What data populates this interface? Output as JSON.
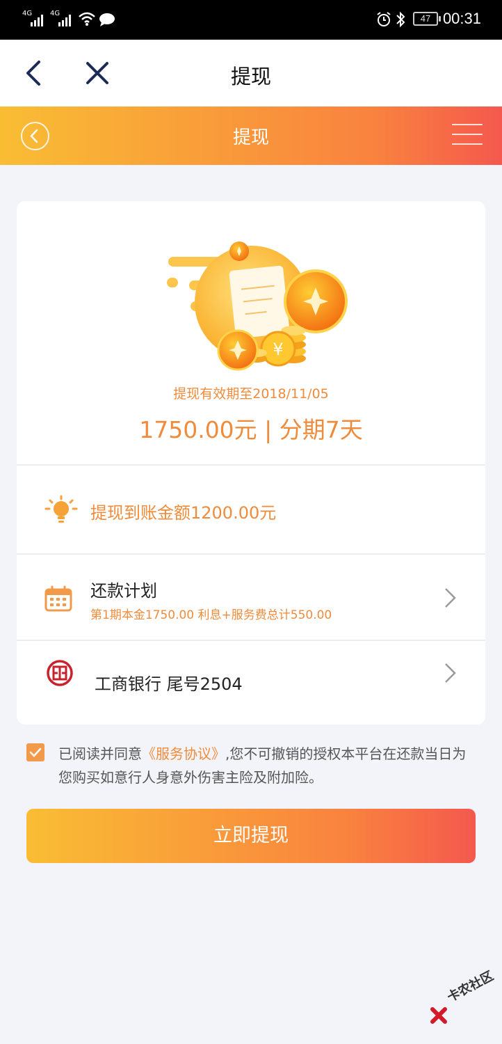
{
  "status_bar": {
    "signal_1": "4G",
    "signal_2": "4G",
    "battery": "47",
    "time": "00:31"
  },
  "nav": {
    "title": "提现"
  },
  "header": {
    "title": "提现"
  },
  "card": {
    "validity": "提现有效期至2018/11/05",
    "amount": "1750.00元 | 分期7天",
    "received": "提现到账金额1200.00元",
    "plan_title": "还款计划",
    "plan_detail": "第1期本金1750.00 利息+服务费总计550.00",
    "bank": "工商银行 尾号2504"
  },
  "agreement": {
    "prefix": "已阅读并同意",
    "link": "《服务协议》",
    "suffix": ",您不可撤销的授权本平台在还款当日为您购买如意行人身意外伤害主险及附加险。"
  },
  "submit_label": "立即提现",
  "watermark": "卡农社区",
  "colors": {
    "accent": "#ef8b3b",
    "gradient_start": "#f9bd34",
    "gradient_end": "#f4584e"
  }
}
